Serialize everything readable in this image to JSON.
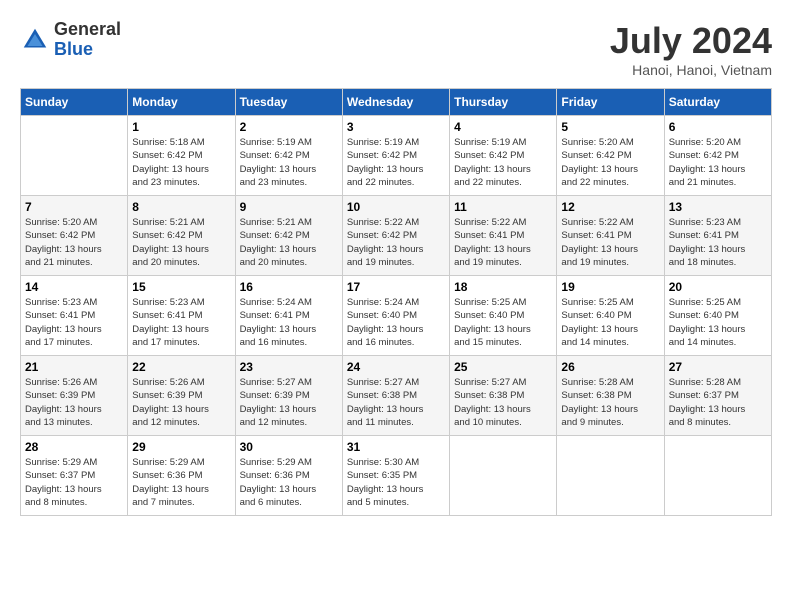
{
  "header": {
    "logo_general": "General",
    "logo_blue": "Blue",
    "title": "July 2024",
    "location": "Hanoi, Hanoi, Vietnam"
  },
  "weekdays": [
    "Sunday",
    "Monday",
    "Tuesday",
    "Wednesday",
    "Thursday",
    "Friday",
    "Saturday"
  ],
  "weeks": [
    [
      {
        "day": "",
        "info": ""
      },
      {
        "day": "1",
        "info": "Sunrise: 5:18 AM\nSunset: 6:42 PM\nDaylight: 13 hours\nand 23 minutes."
      },
      {
        "day": "2",
        "info": "Sunrise: 5:19 AM\nSunset: 6:42 PM\nDaylight: 13 hours\nand 23 minutes."
      },
      {
        "day": "3",
        "info": "Sunrise: 5:19 AM\nSunset: 6:42 PM\nDaylight: 13 hours\nand 22 minutes."
      },
      {
        "day": "4",
        "info": "Sunrise: 5:19 AM\nSunset: 6:42 PM\nDaylight: 13 hours\nand 22 minutes."
      },
      {
        "day": "5",
        "info": "Sunrise: 5:20 AM\nSunset: 6:42 PM\nDaylight: 13 hours\nand 22 minutes."
      },
      {
        "day": "6",
        "info": "Sunrise: 5:20 AM\nSunset: 6:42 PM\nDaylight: 13 hours\nand 21 minutes."
      }
    ],
    [
      {
        "day": "7",
        "info": ""
      },
      {
        "day": "8",
        "info": "Sunrise: 5:21 AM\nSunset: 6:42 PM\nDaylight: 13 hours\nand 20 minutes."
      },
      {
        "day": "9",
        "info": "Sunrise: 5:21 AM\nSunset: 6:42 PM\nDaylight: 13 hours\nand 20 minutes."
      },
      {
        "day": "10",
        "info": "Sunrise: 5:22 AM\nSunset: 6:42 PM\nDaylight: 13 hours\nand 19 minutes."
      },
      {
        "day": "11",
        "info": "Sunrise: 5:22 AM\nSunset: 6:41 PM\nDaylight: 13 hours\nand 19 minutes."
      },
      {
        "day": "12",
        "info": "Sunrise: 5:22 AM\nSunset: 6:41 PM\nDaylight: 13 hours\nand 19 minutes."
      },
      {
        "day": "13",
        "info": "Sunrise: 5:23 AM\nSunset: 6:41 PM\nDaylight: 13 hours\nand 18 minutes."
      }
    ],
    [
      {
        "day": "14",
        "info": ""
      },
      {
        "day": "15",
        "info": "Sunrise: 5:23 AM\nSunset: 6:41 PM\nDaylight: 13 hours\nand 17 minutes."
      },
      {
        "day": "16",
        "info": "Sunrise: 5:24 AM\nSunset: 6:41 PM\nDaylight: 13 hours\nand 16 minutes."
      },
      {
        "day": "17",
        "info": "Sunrise: 5:24 AM\nSunset: 6:40 PM\nDaylight: 13 hours\nand 16 minutes."
      },
      {
        "day": "18",
        "info": "Sunrise: 5:25 AM\nSunset: 6:40 PM\nDaylight: 13 hours\nand 15 minutes."
      },
      {
        "day": "19",
        "info": "Sunrise: 5:25 AM\nSunset: 6:40 PM\nDaylight: 13 hours\nand 14 minutes."
      },
      {
        "day": "20",
        "info": "Sunrise: 5:25 AM\nSunset: 6:40 PM\nDaylight: 13 hours\nand 14 minutes."
      }
    ],
    [
      {
        "day": "21",
        "info": ""
      },
      {
        "day": "22",
        "info": "Sunrise: 5:26 AM\nSunset: 6:39 PM\nDaylight: 13 hours\nand 12 minutes."
      },
      {
        "day": "23",
        "info": "Sunrise: 5:27 AM\nSunset: 6:39 PM\nDaylight: 13 hours\nand 12 minutes."
      },
      {
        "day": "24",
        "info": "Sunrise: 5:27 AM\nSunset: 6:38 PM\nDaylight: 13 hours\nand 11 minutes."
      },
      {
        "day": "25",
        "info": "Sunrise: 5:27 AM\nSunset: 6:38 PM\nDaylight: 13 hours\nand 10 minutes."
      },
      {
        "day": "26",
        "info": "Sunrise: 5:28 AM\nSunset: 6:38 PM\nDaylight: 13 hours\nand 9 minutes."
      },
      {
        "day": "27",
        "info": "Sunrise: 5:28 AM\nSunset: 6:37 PM\nDaylight: 13 hours\nand 8 minutes."
      }
    ],
    [
      {
        "day": "28",
        "info": "Sunrise: 5:29 AM\nSunset: 6:37 PM\nDaylight: 13 hours\nand 8 minutes."
      },
      {
        "day": "29",
        "info": "Sunrise: 5:29 AM\nSunset: 6:36 PM\nDaylight: 13 hours\nand 7 minutes."
      },
      {
        "day": "30",
        "info": "Sunrise: 5:29 AM\nSunset: 6:36 PM\nDaylight: 13 hours\nand 6 minutes."
      },
      {
        "day": "31",
        "info": "Sunrise: 5:30 AM\nSunset: 6:35 PM\nDaylight: 13 hours\nand 5 minutes."
      },
      {
        "day": "",
        "info": ""
      },
      {
        "day": "",
        "info": ""
      },
      {
        "day": "",
        "info": ""
      }
    ]
  ],
  "week1_sunday_info": "Sunrise: 5:20 AM\nSunset: 6:42 PM\nDaylight: 13 hours\nand 21 minutes.",
  "week2_sunday_info": "Sunrise: 5:20 AM\nSunset: 6:42 PM\nDaylight: 13 hours\nand 21 minutes.",
  "week3_sunday_info": "Sunrise: 5:23 AM\nSunset: 6:41 PM\nDaylight: 13 hours\nand 17 minutes.",
  "week4_sunday_info": "Sunrise: 5:26 AM\nSunset: 6:39 PM\nDaylight: 13 hours\nand 13 minutes."
}
